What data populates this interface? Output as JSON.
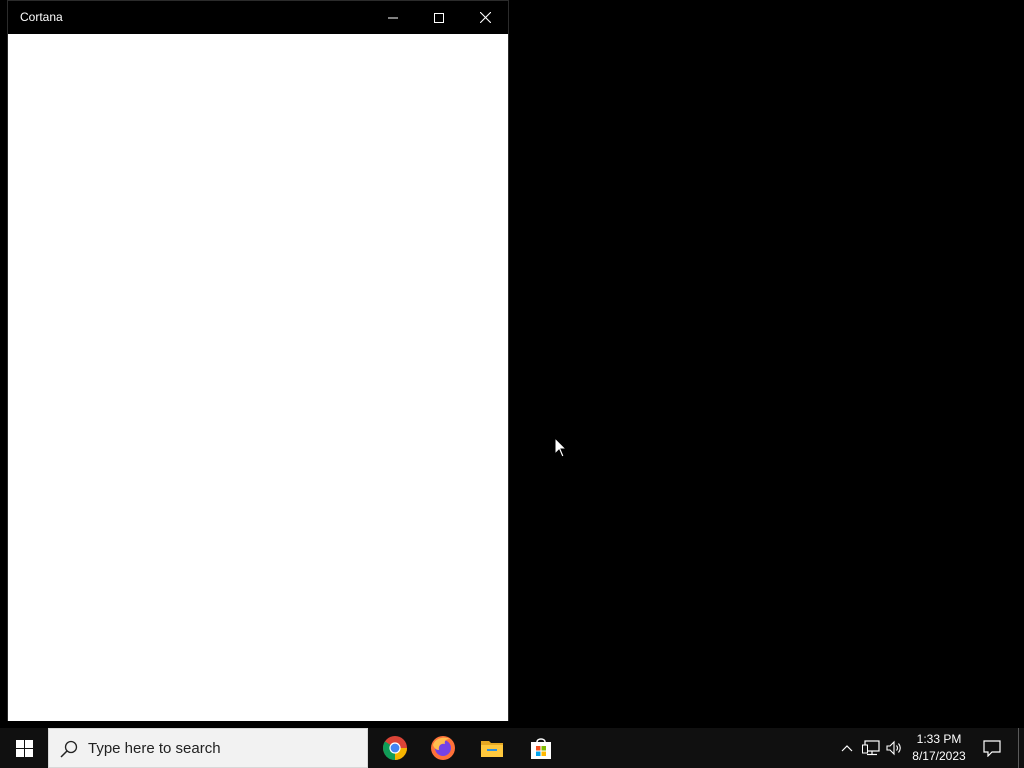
{
  "window": {
    "title": "Cortana",
    "buttons": {
      "minimize_icon": "minimize-icon",
      "maximize_icon": "maximize-icon",
      "close_icon": "close-icon"
    },
    "colors": {
      "titlebar_bg": "#000000",
      "content_bg": "#ffffff"
    }
  },
  "desktop": {
    "background": "#000000"
  },
  "taskbar": {
    "start_icon": "windows-logo-icon",
    "search": {
      "placeholder": "Type here to search",
      "icon": "search-icon"
    },
    "pinned_apps": [
      {
        "name": "chrome",
        "icon": "chrome-icon"
      },
      {
        "name": "firefox",
        "icon": "firefox-icon"
      },
      {
        "name": "file-explorer",
        "icon": "folder-icon"
      },
      {
        "name": "microsoft-store",
        "icon": "store-icon"
      }
    ],
    "tray": {
      "chevron_icon": "chevron-up-icon",
      "network_icon": "network-icon",
      "volume_icon": "volume-icon",
      "time": "1:33 PM",
      "date": "8/17/2023",
      "notification_icon": "notification-icon"
    }
  }
}
